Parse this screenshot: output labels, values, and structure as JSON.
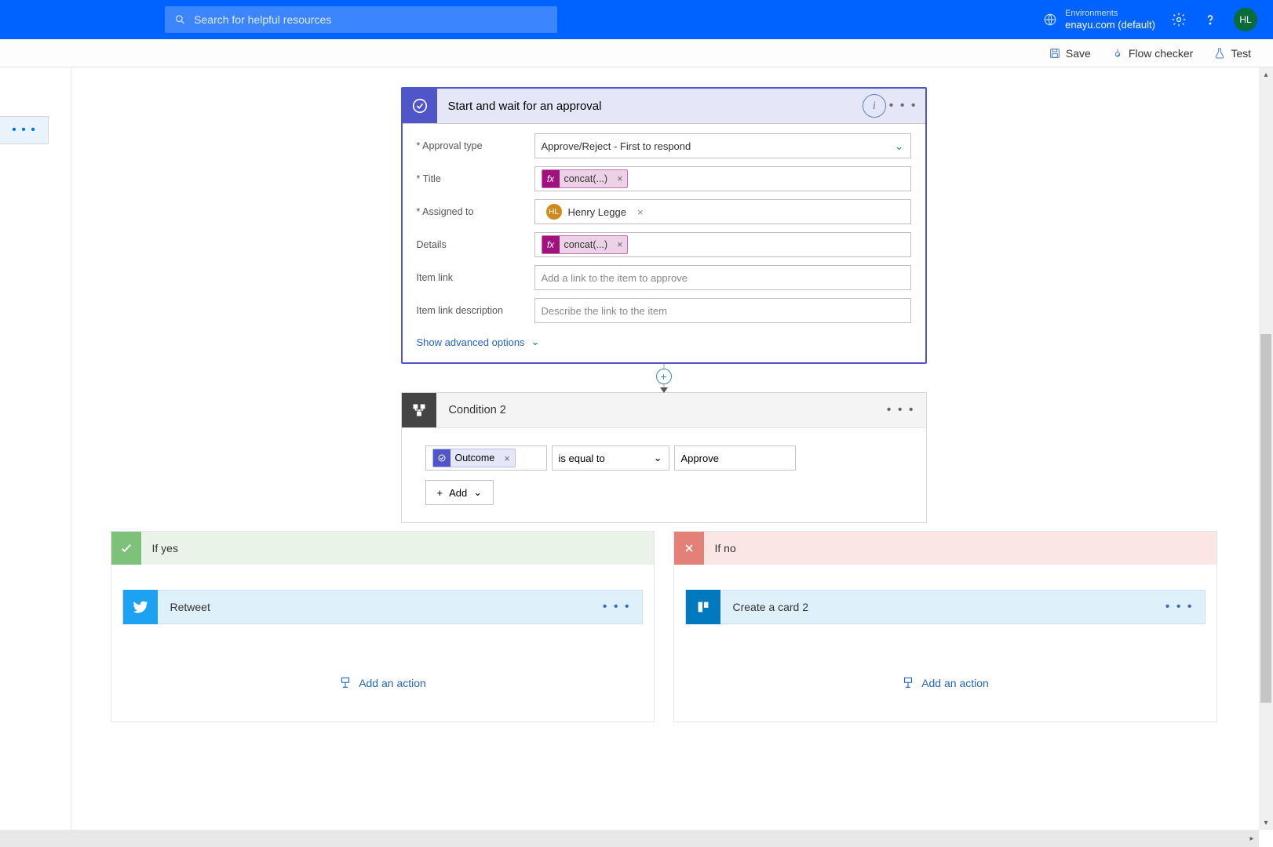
{
  "header": {
    "search_placeholder": "Search for helpful resources",
    "env_label": "Environments",
    "env_value": "enayu.com (default)",
    "avatar": "HL"
  },
  "toolbar": {
    "save": "Save",
    "flowchecker": "Flow checker",
    "test": "Test"
  },
  "left_stub_dots": "• • •",
  "approval": {
    "title": "Start and wait for an approval",
    "fields": {
      "approval_type_label": "Approval type",
      "approval_type_value": "Approve/Reject - First to respond",
      "title_label": "Title",
      "title_token": "concat(...)",
      "assigned_label": "Assigned to",
      "assigned_user": "Henry Legge",
      "assigned_initials": "HL",
      "details_label": "Details",
      "details_token": "concat(...)",
      "itemlink_label": "Item link",
      "itemlink_placeholder": "Add a link to the item to approve",
      "itemlinkdesc_label": "Item link description",
      "itemlinkdesc_placeholder": "Describe the link to the item"
    },
    "show_advanced": "Show advanced options"
  },
  "condition": {
    "title": "Condition 2",
    "outcome_token": "Outcome",
    "operator": "is equal to",
    "value": "Approve",
    "add_label": "Add"
  },
  "branches": {
    "yes_label": "If yes",
    "no_label": "If no",
    "yes_action": "Retweet",
    "no_action": "Create a card 2",
    "add_action": "Add an action"
  }
}
